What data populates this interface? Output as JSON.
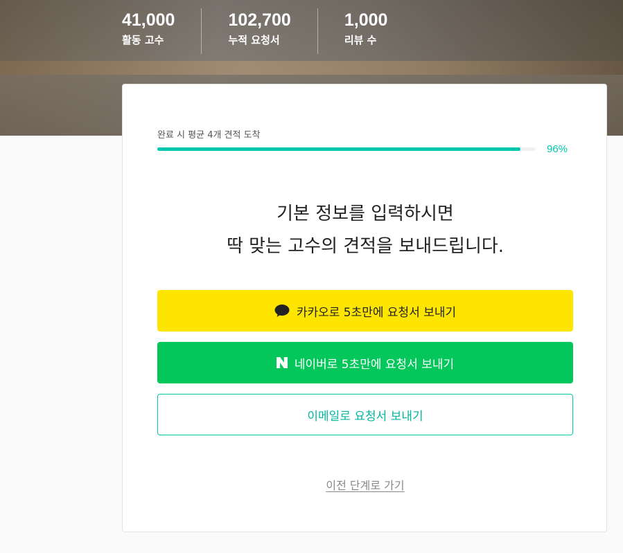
{
  "stats": [
    {
      "value": "41,000",
      "label": "활동 고수"
    },
    {
      "value": "102,700",
      "label": "누적 요청서"
    },
    {
      "value": "1,000",
      "label": "리뷰 수"
    }
  ],
  "progress": {
    "label": "완료 시 평균 4개 견적 도착",
    "percent_text": "96%",
    "percent": 96
  },
  "headline": {
    "line1": "기본 정보를 입력하시면",
    "line2": "딱 맞는 고수의 견적을 보내드립니다."
  },
  "buttons": {
    "kakao": {
      "label": "카카오로 5초만에 요청서 보내기",
      "icon": "speech-bubble-icon"
    },
    "naver": {
      "label": "네이버로 5초만에 요청서 보내기",
      "icon": "naver-n-icon"
    },
    "email": {
      "label": "이메일로 요청서 보내기"
    }
  },
  "back_link": "이전 단계로 가기",
  "colors": {
    "accent": "#00c7ae",
    "kakao": "#fee500",
    "naver": "#03c75a"
  }
}
